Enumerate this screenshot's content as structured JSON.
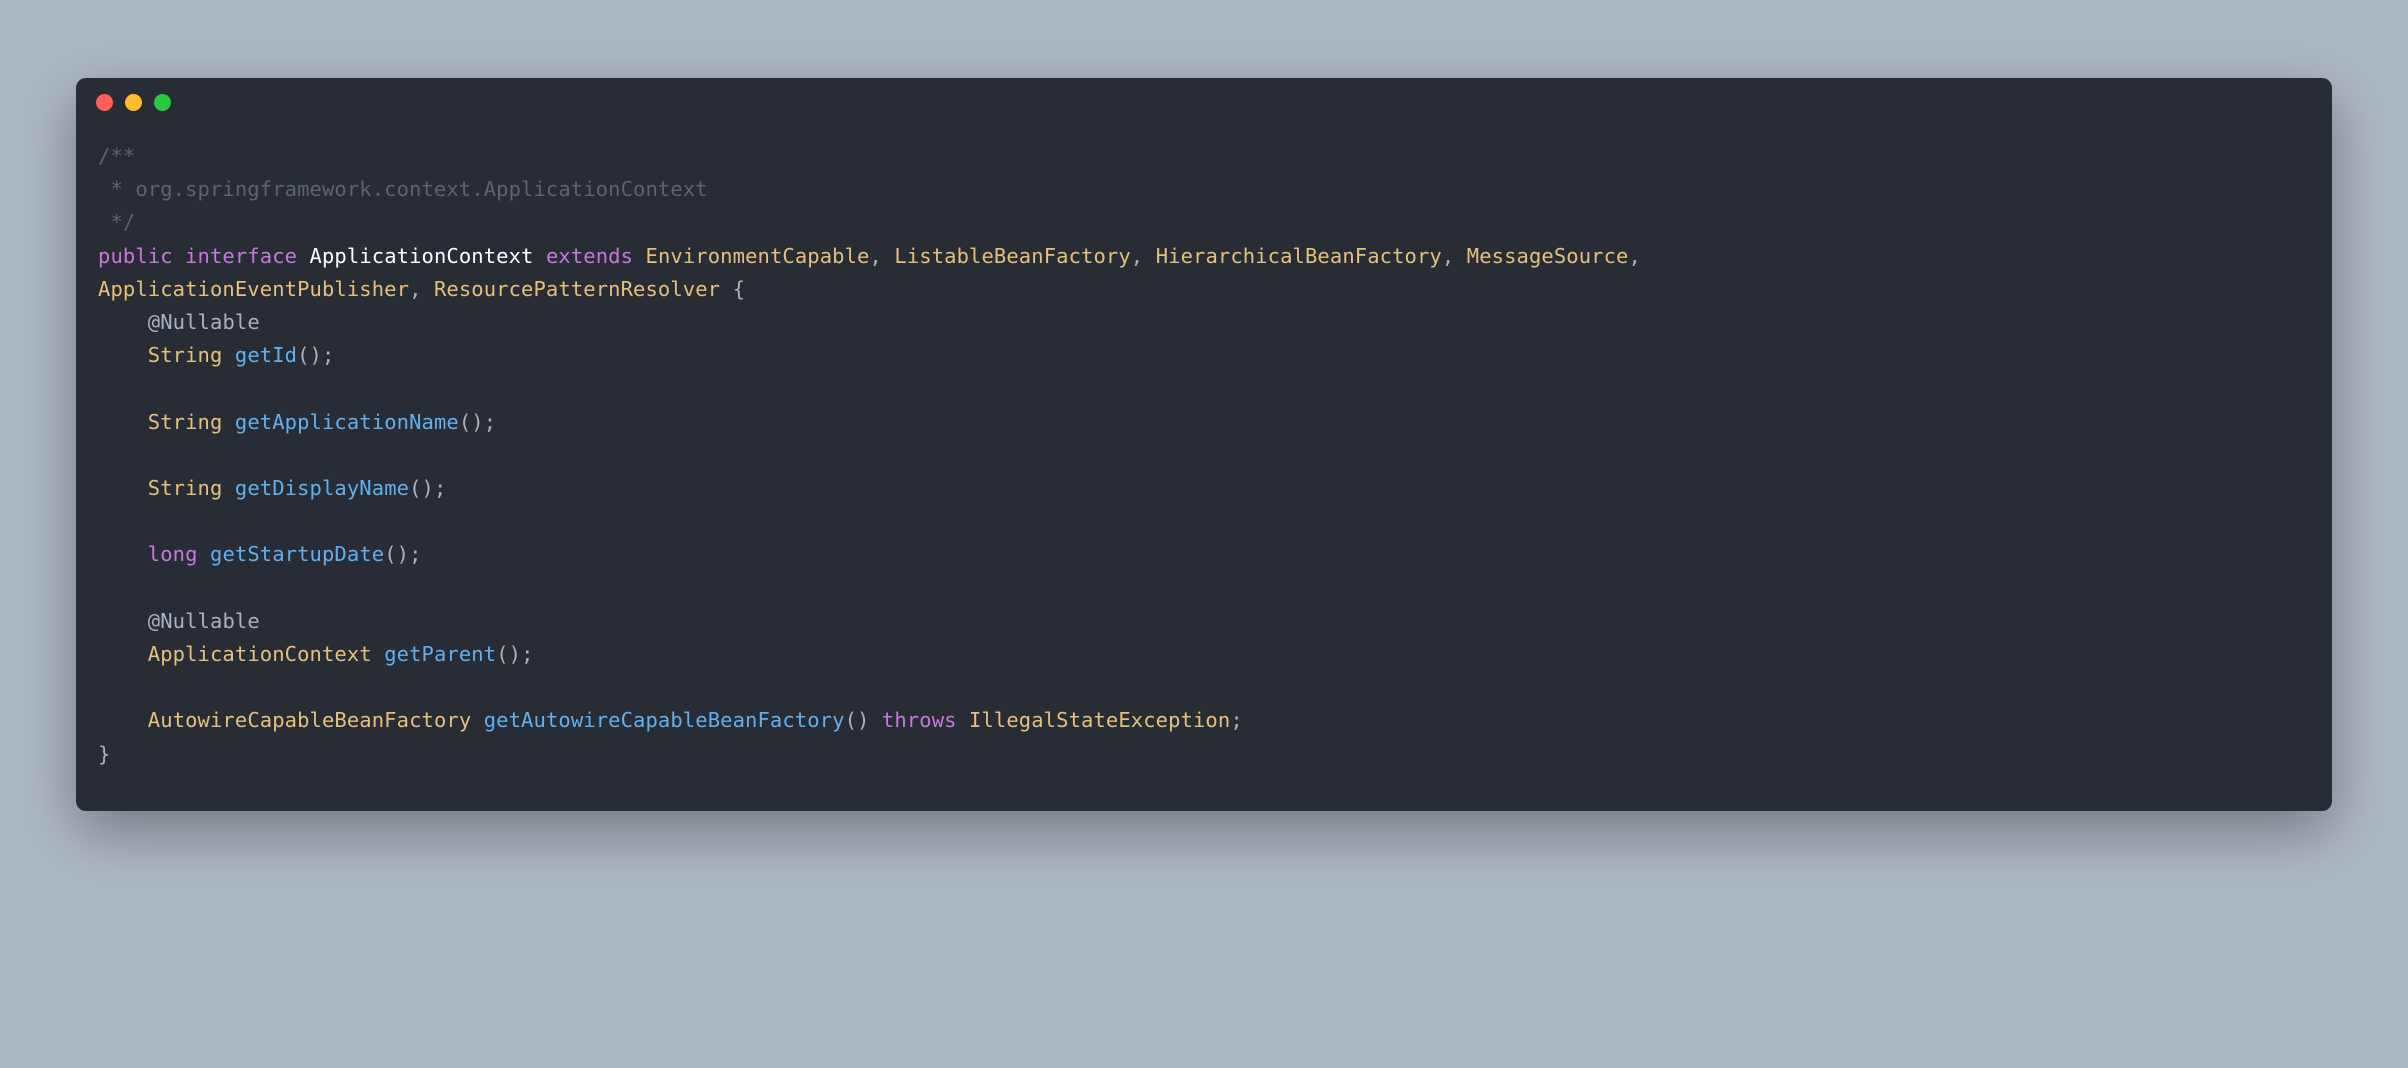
{
  "comment": {
    "line1": "/**",
    "line2": " * org.springframework.context.ApplicationContext",
    "line3": " */"
  },
  "keywords": {
    "public": "public",
    "interface": "interface",
    "extends": "extends",
    "throws": "throws",
    "long": "long"
  },
  "interfaceName": "ApplicationContext",
  "superTypes": {
    "EnvironmentCapable": "EnvironmentCapable",
    "ListableBeanFactory": "ListableBeanFactory",
    "HierarchicalBeanFactory": "HierarchicalBeanFactory",
    "MessageSource": "MessageSource",
    "ApplicationEventPublisher": "ApplicationEventPublisher",
    "ResourcePatternResolver": "ResourcePatternResolver"
  },
  "annotations": {
    "Nullable": "Nullable"
  },
  "types": {
    "String": "String",
    "ApplicationContext": "ApplicationContext",
    "AutowireCapableBeanFactory": "AutowireCapableBeanFactory",
    "IllegalStateException": "IllegalStateException"
  },
  "methods": {
    "getId": "getId",
    "getApplicationName": "getApplicationName",
    "getDisplayName": "getDisplayName",
    "getStartupDate": "getStartupDate",
    "getParent": "getParent",
    "getAutowireCapableBeanFactory": "getAutowireCapableBeanFactory"
  },
  "punct": {
    "comma": ",",
    "commaSpace": ", ",
    "openBrace": " {",
    "closeBrace": "}",
    "parenSemi": "();",
    "openParen": "(",
    "closeParen": ")",
    "semicolon": ";",
    "at": "@",
    "space": " "
  }
}
